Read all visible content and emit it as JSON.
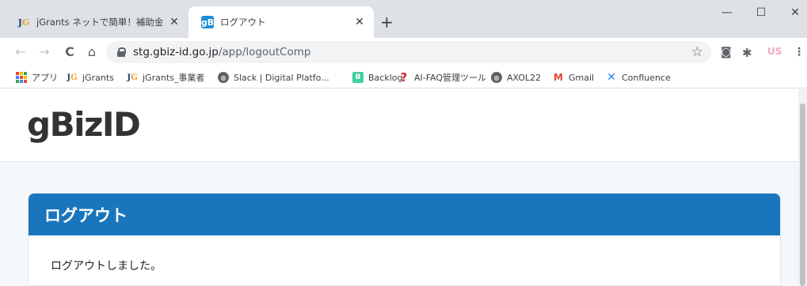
{
  "browser": {
    "tabs": [
      {
        "title": "jGrants ネットで簡単！補助金申請",
        "favicon": "jgrants-icon",
        "active": false
      },
      {
        "title": "ログアウト",
        "favicon": "gbizid-icon",
        "active": true
      }
    ],
    "new_tab_glyph": "+",
    "window_controls": {
      "minimize": "—",
      "maximize": "☐",
      "close": "✕"
    },
    "nav": {
      "back": "←",
      "forward": "→",
      "reload": "C",
      "home": "⌂"
    },
    "address": {
      "host": "stg.gbiz-id.go.jp",
      "path": "/app/logoutComp"
    },
    "profile": "US",
    "bookmarks": [
      {
        "label": "アプリ",
        "icon": "apps-grid-icon"
      },
      {
        "label": "jGrants",
        "icon": "jgrants-icon"
      },
      {
        "label": "jGrants_事業者",
        "icon": "jgrants-icon"
      },
      {
        "label": "Slack | Digital Platfo...",
        "icon": "globe-icon"
      },
      {
        "label": "Backlog",
        "icon": "backlog-icon"
      },
      {
        "label": "AI-FAQ管理ツール",
        "icon": "question-mark-icon"
      },
      {
        "label": "AXOL22",
        "icon": "globe-icon"
      },
      {
        "label": "Gmail",
        "icon": "gmail-icon"
      },
      {
        "label": "Confluence",
        "icon": "confluence-icon"
      }
    ]
  },
  "page": {
    "logo": "gBizID",
    "card": {
      "title": "ログアウト",
      "message": "ログアウトしました。"
    }
  },
  "colors": {
    "card_header": "#1976bc",
    "page_background": "#f4f8fb",
    "tabstrip": "#dee1e6"
  }
}
